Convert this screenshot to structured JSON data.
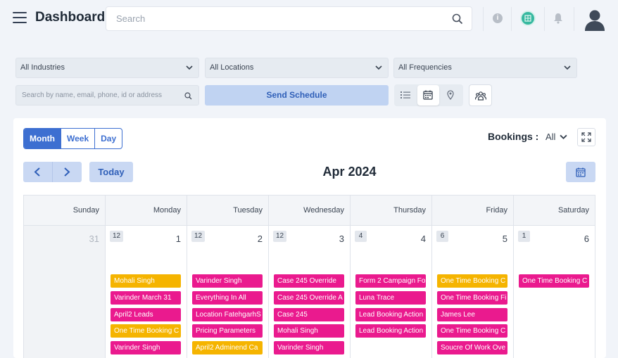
{
  "header": {
    "title": "Dashboard",
    "search_placeholder": "Search"
  },
  "filters": {
    "industries": "All Industries",
    "locations": "All Locations",
    "frequencies": "All Frequencies",
    "search_placeholder": "Search by name, email, phone, id or address",
    "send_schedule": "Send Schedule"
  },
  "calendar": {
    "views": [
      "Month",
      "Week",
      "Day"
    ],
    "active_view": "Month",
    "bookings_label": "Bookings :",
    "bookings_filter": "All",
    "today_label": "Today",
    "month_title": "Apr 2024",
    "weekdays": [
      "Sunday",
      "Monday",
      "Tuesday",
      "Wednesday",
      "Thursday",
      "Friday",
      "Saturday"
    ],
    "days": [
      {
        "date": "31",
        "count": "",
        "other_month": true,
        "events": []
      },
      {
        "date": "1",
        "count": "12",
        "other_month": false,
        "events": [
          {
            "label": "Mohali Singh",
            "color": "#f5b400"
          },
          {
            "label": "Varinder March 31",
            "color": "#ea1a8e"
          },
          {
            "label": "April2 Leads",
            "color": "#ea1a8e"
          },
          {
            "label": "One Time Booking C",
            "color": "#f5b400"
          },
          {
            "label": "Varinder Singh",
            "color": "#ea1a8e"
          }
        ]
      },
      {
        "date": "2",
        "count": "12",
        "other_month": false,
        "events": [
          {
            "label": "Varinder Singh",
            "color": "#ea1a8e"
          },
          {
            "label": "Everything In All",
            "color": "#ea1a8e"
          },
          {
            "label": "Location FatehgarhS",
            "color": "#ea1a8e"
          },
          {
            "label": "Pricing Parameters",
            "color": "#ea1a8e"
          },
          {
            "label": "April2 Adminend Ca",
            "color": "#f5b400"
          }
        ]
      },
      {
        "date": "3",
        "count": "12",
        "other_month": false,
        "events": [
          {
            "label": "Case 245 Override",
            "color": "#ea1a8e"
          },
          {
            "label": "Case 245 Override A",
            "color": "#ea1a8e"
          },
          {
            "label": "Case 245",
            "color": "#ea1a8e"
          },
          {
            "label": "Mohali Singh",
            "color": "#ea1a8e"
          },
          {
            "label": "Varinder Singh",
            "color": "#ea1a8e"
          }
        ]
      },
      {
        "date": "4",
        "count": "4",
        "other_month": false,
        "events": [
          {
            "label": "Form 2 Campaign Fo",
            "color": "#ea1a8e"
          },
          {
            "label": "Luna Trace",
            "color": "#ea1a8e"
          },
          {
            "label": "Lead Booking Action",
            "color": "#ea1a8e"
          },
          {
            "label": "Lead Booking Action",
            "color": "#ea1a8e"
          }
        ]
      },
      {
        "date": "5",
        "count": "6",
        "other_month": false,
        "events": [
          {
            "label": "One Time Booking C",
            "color": "#f5b400"
          },
          {
            "label": "One Time Booking Fi",
            "color": "#ea1a8e"
          },
          {
            "label": "James Lee",
            "color": "#ea1a8e"
          },
          {
            "label": "One Time Booking C",
            "color": "#ea1a8e"
          },
          {
            "label": "Soucre Of Work Ove",
            "color": "#ea1a8e"
          }
        ]
      },
      {
        "date": "6",
        "count": "1",
        "other_month": false,
        "events": [
          {
            "label": "One Time Booking C",
            "color": "#ea1a8e"
          }
        ]
      }
    ]
  },
  "colors": {
    "accent": "#3d6fd1",
    "event_pink": "#ea1a8e",
    "event_yellow": "#f5b400"
  },
  "icons": [
    "menu-icon",
    "search-icon",
    "info-icon",
    "globe-icon",
    "bell-icon",
    "user-avatar-icon",
    "list-view-icon",
    "calendar-view-icon",
    "map-pin-icon",
    "team-icon",
    "expand-icon",
    "chevron-left-icon",
    "chevron-right-icon",
    "calendar-icon"
  ]
}
